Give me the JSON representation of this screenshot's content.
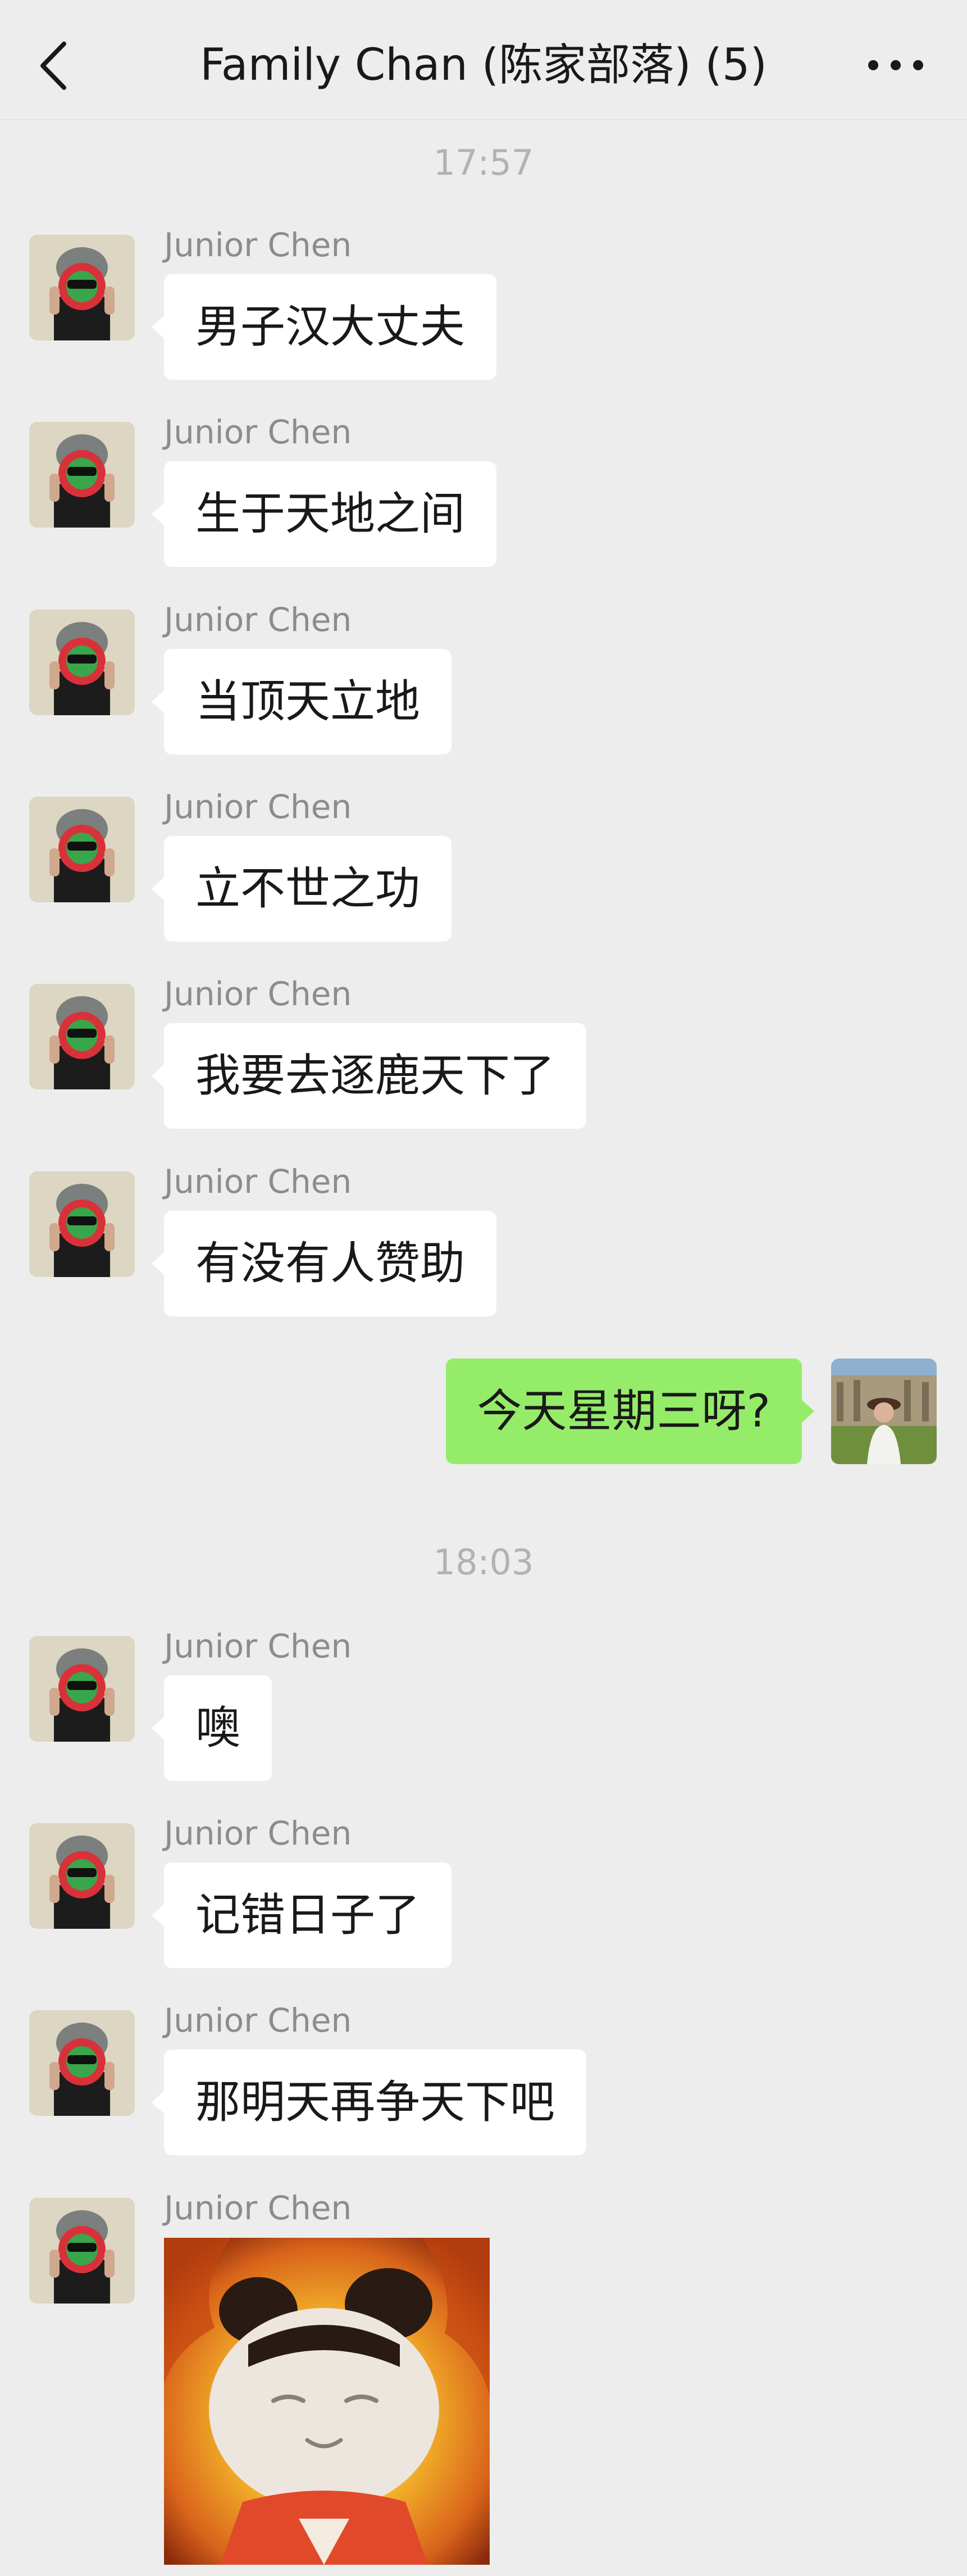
{
  "header": {
    "title": "Family Chan (陈家部落) (5)",
    "back_icon": "back-chevron-icon",
    "more_icon": "more-dots-icon"
  },
  "timestamps": [
    "17:57",
    "18:03"
  ],
  "messages": [
    {
      "sender": "Junior Chen",
      "text": "男子汉大丈夫"
    },
    {
      "sender": "Junior Chen",
      "text": "生于天地之间"
    },
    {
      "sender": "Junior Chen",
      "text": "当顶天立地"
    },
    {
      "sender": "Junior Chen",
      "text": "立不世之功"
    },
    {
      "sender": "Junior Chen",
      "text": "我要去逐鹿天下了"
    },
    {
      "sender": "Junior Chen",
      "text": "有没有人赞助"
    },
    {
      "sender": "me",
      "text": "今天星期三呀?"
    },
    {
      "sender": "Junior Chen",
      "text": "噢"
    },
    {
      "sender": "Junior Chen",
      "text": "记错日子了"
    },
    {
      "sender": "Junior Chen",
      "text": "那明天再争天下吧"
    },
    {
      "sender": "Junior Chen",
      "sticker": "cartoon-doll-sticker"
    }
  ],
  "colors": {
    "background": "#ededed",
    "incoming_bubble": "#ffffff",
    "outgoing_bubble": "#95ec69",
    "name_text": "#8c8c8c",
    "timestamp_text": "#b2b2b2"
  }
}
